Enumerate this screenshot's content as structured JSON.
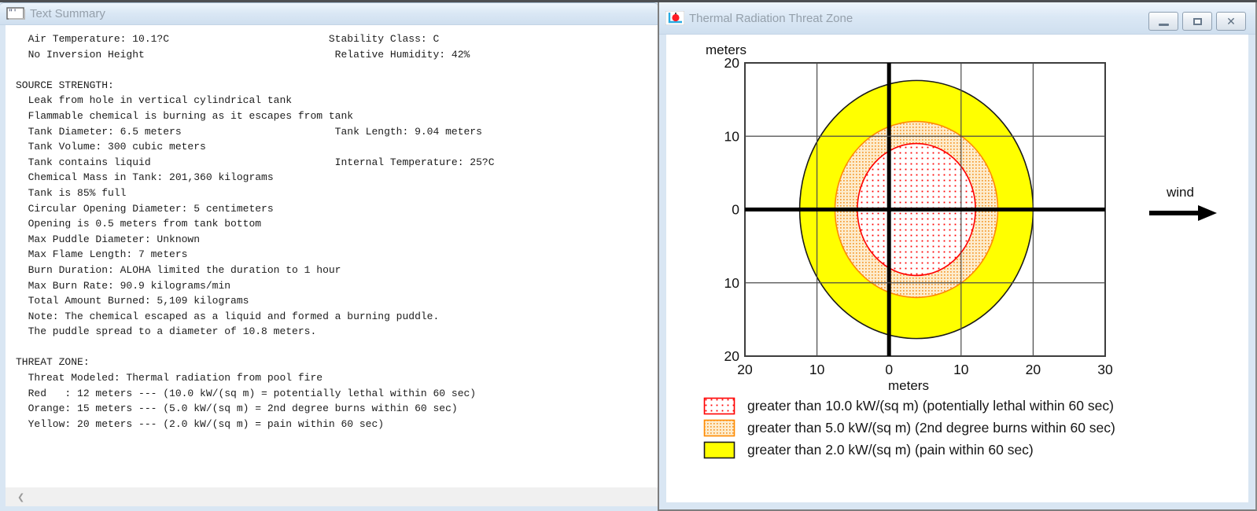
{
  "colors": {
    "yellow": "#ffff00",
    "orange_dot": "#f59b31",
    "orange_bg": "#fdeccd",
    "orange_line": "#ff8a00",
    "red": "#ff0000",
    "zone_outline_dark": "#1a1a1a",
    "grid": "#4a4a4a",
    "axis": "#000000"
  },
  "left_window": {
    "title": "Text Summary",
    "scrollbar_left_arrow": "❮",
    "summary_lines": [
      "  Air Temperature: 10.1?C                          Stability Class: C",
      "  No Inversion Height                               Relative Humidity: 42%",
      "",
      "SOURCE STRENGTH:",
      "  Leak from hole in vertical cylindrical tank",
      "  Flammable chemical is burning as it escapes from tank",
      "  Tank Diameter: 6.5 meters                         Tank Length: 9.04 meters",
      "  Tank Volume: 300 cubic meters",
      "  Tank contains liquid                              Internal Temperature: 25?C",
      "  Chemical Mass in Tank: 201,360 kilograms",
      "  Tank is 85% full",
      "  Circular Opening Diameter: 5 centimeters",
      "  Opening is 0.5 meters from tank bottom",
      "  Max Puddle Diameter: Unknown",
      "  Max Flame Length: 7 meters",
      "  Burn Duration: ALOHA limited the duration to 1 hour",
      "  Max Burn Rate: 90.9 kilograms/min",
      "  Total Amount Burned: 5,109 kilograms",
      "  Note: The chemical escaped as a liquid and formed a burning puddle.",
      "  The puddle spread to a diameter of 10.8 meters.",
      "",
      "THREAT ZONE:",
      "  Threat Modeled: Thermal radiation from pool fire",
      "  Red   : 12 meters --- (10.0 kW/(sq m) = potentially lethal within 60 sec)",
      "  Orange: 15 meters --- (5.0 kW/(sq m) = 2nd degree burns within 60 sec)",
      "  Yellow: 20 meters --- (2.0 kW/(sq m) = pain within 60 sec)"
    ]
  },
  "right_window": {
    "title": "Thermal Radiation Threat Zone",
    "buttons": {
      "close_glyph": "✕"
    },
    "plot": {
      "y_axis_label": "meters",
      "x_axis_label": "meters",
      "wind_label": "wind"
    },
    "legend": [
      {
        "label": "greater than 10.0 kW/(sq m) (potentially lethal within 60 sec)"
      },
      {
        "label": "greater than 5.0 kW/(sq m) (2nd degree burns within 60 sec)"
      },
      {
        "label": "greater than 2.0 kW/(sq m) (pain within 60 sec)"
      }
    ]
  },
  "chart_data": {
    "type": "area",
    "title": "Thermal Radiation Threat Zone",
    "xlabel": "meters",
    "ylabel": "meters",
    "xlim": [
      -20,
      30
    ],
    "ylim": [
      -20,
      20
    ],
    "x_ticks": [
      -20,
      -10,
      0,
      10,
      20,
      30
    ],
    "y_ticks": [
      20,
      10,
      0,
      -10,
      -20
    ],
    "grid": true,
    "legend_position": "below",
    "wind_direction": "right (+x, downwind)",
    "zones": [
      {
        "name": "red-threat-zone",
        "threshold": "greater than 10.0 kW/(sq m)",
        "effect": "potentially lethal within 60 sec",
        "threat_distance_m": 12,
        "center_x_m": 3.8,
        "center_y_m": 0,
        "rx_m": 8.2,
        "ry_m": 9.0,
        "line_color": "#ff0000",
        "fill_key": "red"
      },
      {
        "name": "orange-threat-zone",
        "threshold": "greater than 5.0 kW/(sq m)",
        "effect": "2nd degree burns within 60 sec",
        "threat_distance_m": 15,
        "center_x_m": 3.8,
        "center_y_m": 0,
        "rx_m": 11.3,
        "ry_m": 12.0,
        "line_color": "#ff8a00",
        "fill_key": "orange"
      },
      {
        "name": "yellow-threat-zone",
        "threshold": "greater than 2.0 kW/(sq m)",
        "effect": "pain within 60 sec",
        "threat_distance_m": 20,
        "center_x_m": 3.8,
        "center_y_m": 0,
        "rx_m": 16.2,
        "ry_m": 17.6,
        "line_color": "#1a1a1a",
        "fill_key": "yellow"
      }
    ]
  }
}
